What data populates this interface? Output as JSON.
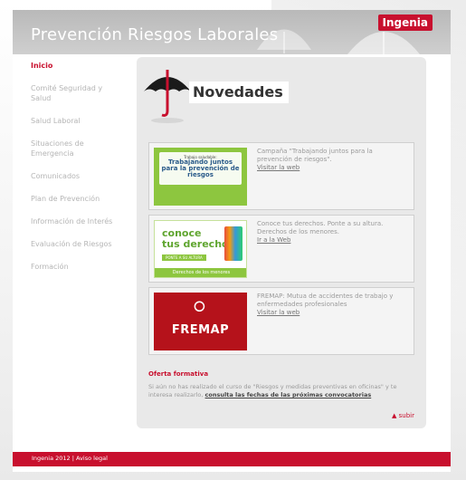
{
  "header": {
    "title": "Prevención Riesgos Laborales",
    "logo": "Ingenia"
  },
  "sidebar": {
    "items": [
      {
        "label": "Inicio",
        "active": true
      },
      {
        "label": "Comité Seguridad y Salud",
        "active": false
      },
      {
        "label": "Salud Laboral",
        "active": false
      },
      {
        "label": "Situaciones de Emergencia",
        "active": false
      },
      {
        "label": "Comunicados",
        "active": false
      },
      {
        "label": "Plan de Prevención",
        "active": false
      },
      {
        "label": "Información de Interés",
        "active": false
      },
      {
        "label": "Evaluación de Riesgos",
        "active": false
      },
      {
        "label": "Formación",
        "active": false
      }
    ]
  },
  "main": {
    "section_title": "Novedades",
    "cards": [
      {
        "image_small": "Trabajo saludable:",
        "image_big": "Trabajando juntos para la prevención de riesgos",
        "text": "Campaña \"Trabajando juntos para la prevención de riesgos\".",
        "link": "Visitar la web"
      },
      {
        "image_line1": "conoce",
        "image_line2": "tus derechos",
        "image_pill": "PONTE A SU ALTURA",
        "image_bar": "Derechos de los menores",
        "text": "Conoce tus derechos. Ponte a su altura. Derechos de los menores.",
        "link": "Ir a la Web"
      },
      {
        "image_logo": "FREMAP",
        "text": "FREMAP: Mutua de accidentes de trabajo y enfermedades profesionales",
        "link": "Visitar la web"
      }
    ],
    "oferta": {
      "title": "Oferta formativa",
      "text_before": "Si aún no has realizado el curso de \"Riesgos y medidas preventivas en oficinas\" y te interesa realizarlo, ",
      "link": "consulta las fechas de las próximas convocatorias"
    },
    "subir": "▲ subir"
  },
  "footer": {
    "text": "Ingenia 2012 | Aviso legal"
  },
  "colors": {
    "brand_red": "#c8102e",
    "header_grey": "#c4c4c4",
    "content_bg": "#e9e9e9",
    "nav_grey": "#b5b5b5",
    "green": "#8dc63f",
    "fremap_red": "#b5121b"
  }
}
